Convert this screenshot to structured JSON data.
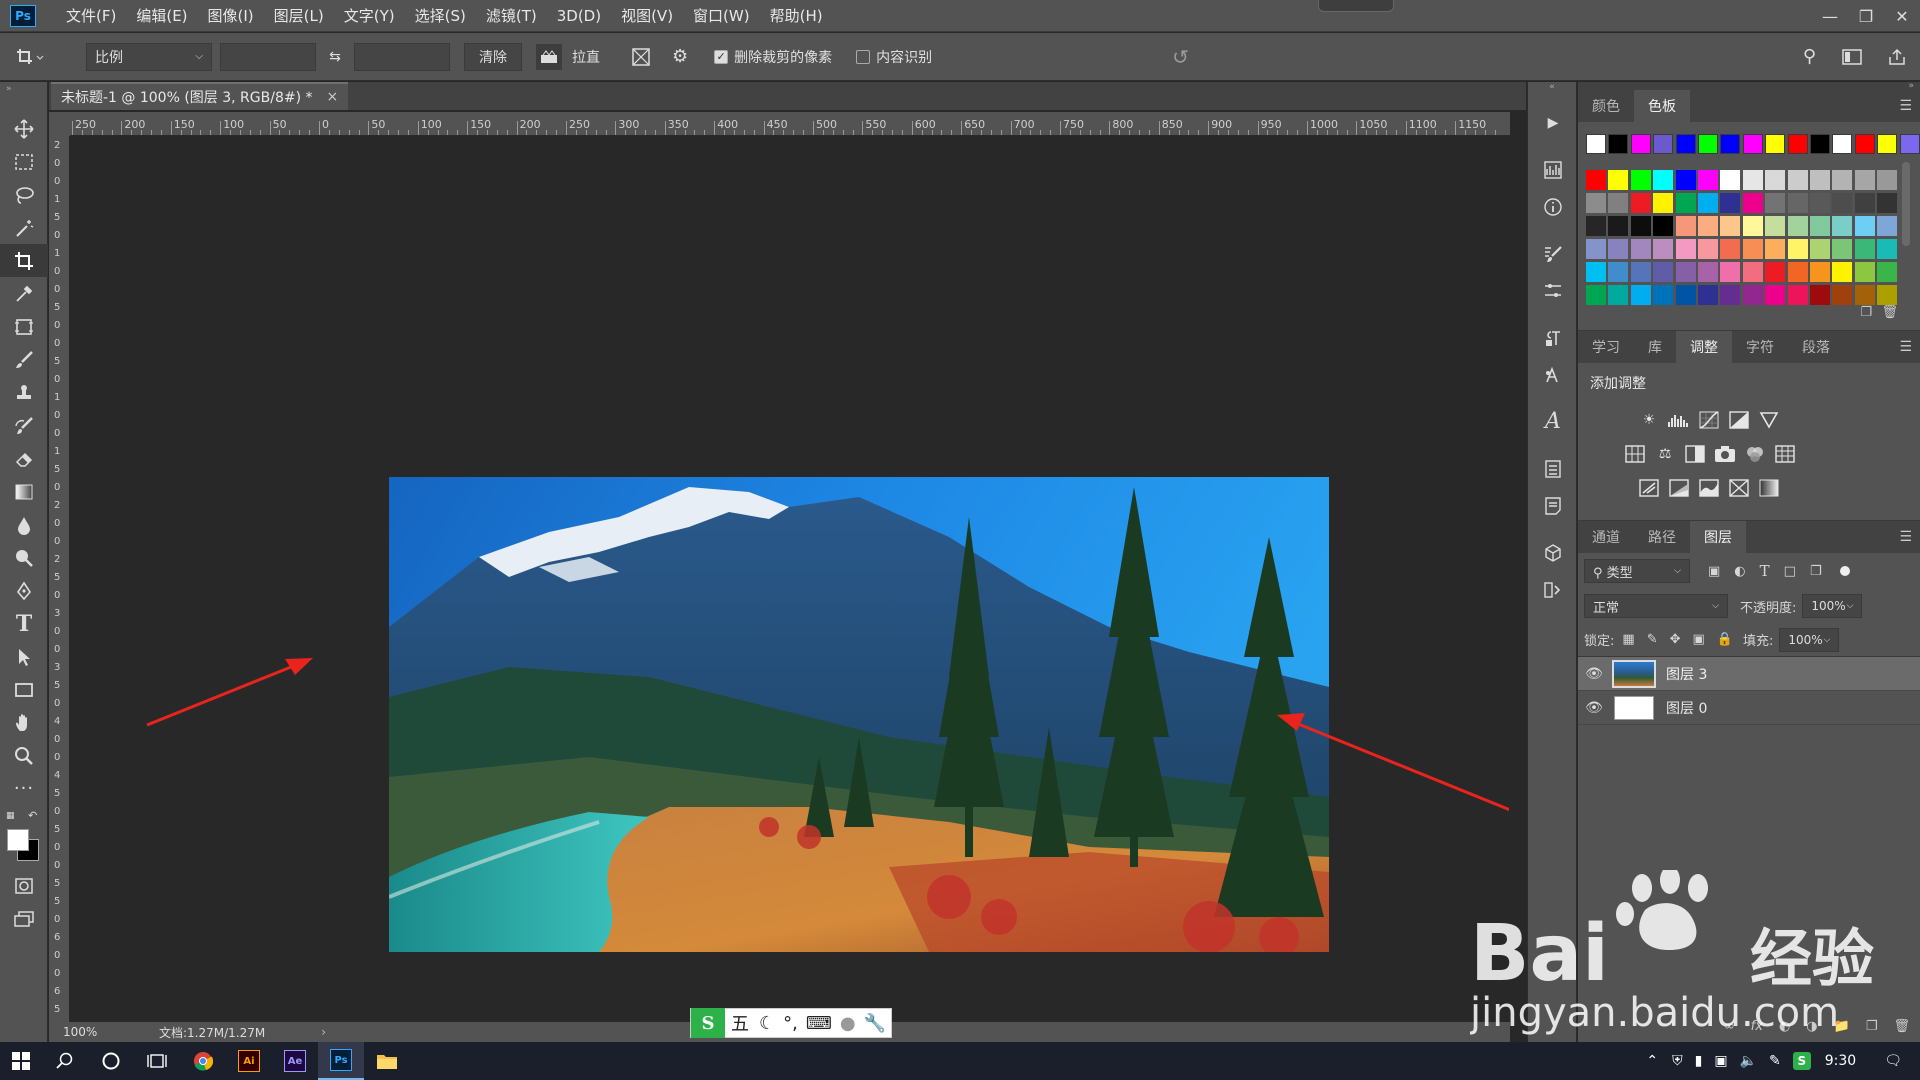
{
  "app": {
    "logo": "Ps"
  },
  "menu": [
    "文件(F)",
    "编辑(E)",
    "图像(I)",
    "图层(L)",
    "文字(Y)",
    "选择(S)",
    "滤镜(T)",
    "3D(D)",
    "视图(V)",
    "窗口(W)",
    "帮助(H)"
  ],
  "options": {
    "ratio_label": "比例",
    "width_value": "",
    "height_value": "",
    "clear_label": "清除",
    "straighten_label": "拉直",
    "delete_cropped_label": "删除裁剪的像素",
    "delete_cropped_checked": true,
    "content_aware_label": "内容识别",
    "content_aware_checked": false
  },
  "document": {
    "tab_title": "未标题-1 @ 100% (图层 3, RGB/8#) *",
    "zoom": "100%",
    "doc_info": "文档:1.27M/1.27M"
  },
  "ruler": {
    "h_labels": [
      "250",
      "200",
      "150",
      "100",
      "50",
      "0",
      "50",
      "100",
      "150",
      "200",
      "250",
      "300",
      "350",
      "400",
      "450",
      "500",
      "550",
      "600",
      "650",
      "700",
      "750",
      "800",
      "850",
      "900",
      "950",
      "1000",
      "1050",
      "1100",
      "1150"
    ],
    "v_labels": [
      "2",
      "0",
      "0",
      "1",
      "5",
      "0",
      "1",
      "0",
      "0",
      "5",
      "0",
      "0",
      "5",
      "0",
      "1",
      "0",
      "0",
      "1",
      "5",
      "0",
      "2",
      "0",
      "0",
      "2",
      "5",
      "0",
      "3",
      "0",
      "0",
      "3",
      "5",
      "0",
      "4",
      "0",
      "0",
      "4",
      "5",
      "0",
      "5",
      "0",
      "0",
      "5",
      "5",
      "0",
      "6",
      "0",
      "0",
      "6",
      "5"
    ]
  },
  "swatches_panel": {
    "tabs": [
      "颜色",
      "色板"
    ],
    "active_tab": "色板",
    "row1": [
      "#ffffff",
      "#000000",
      "#ff00ff",
      "#6a5acd",
      "#0000ff",
      "#00ff00",
      "#0000ff",
      "#ff00ff",
      "#ffff00",
      "#ff0000",
      "#000000",
      "#ffffff",
      "#ff0000",
      "#ffff00",
      "#7b68ee"
    ],
    "grid": [
      [
        "#ff0000",
        "#ffff00",
        "#00ff00",
        "#00ffff",
        "#0000ff",
        "#ff00ff",
        "#ffffff",
        "#e6e6e6",
        "#d9d9d9",
        "#cccccc",
        "#bfbfbf",
        "#b3b3b3",
        "#a6a6a6",
        "#999999"
      ],
      [
        "#8c8c8c",
        "#808080",
        "#ed1c24",
        "#fff200",
        "#00a651",
        "#00aeef",
        "#2e3192",
        "#ec008c",
        "#737373",
        "#666666",
        "#595959",
        "#4d4d4d",
        "#404040",
        "#333333"
      ],
      [
        "#262626",
        "#1a1a1a",
        "#0d0d0d",
        "#000000",
        "#f7977a",
        "#f9ad81",
        "#fdc68a",
        "#fff79a",
        "#c4df9b",
        "#a3d39c",
        "#82ca9d",
        "#7bcdc8",
        "#6ecff6",
        "#7ea7d8"
      ],
      [
        "#8493ca",
        "#8882be",
        "#a187be",
        "#bc8dbf",
        "#f49ac2",
        "#f6989d",
        "#f26c4f",
        "#f68e55",
        "#fbaf5c",
        "#fff467",
        "#acd372",
        "#7cc576",
        "#3bb878",
        "#1abbb4"
      ],
      [
        "#00bff3",
        "#438ccb",
        "#5574b9",
        "#605ca8",
        "#855fa8",
        "#a763a8",
        "#f06ea9",
        "#f26d7d",
        "#ed1c24",
        "#f26522",
        "#f7941d",
        "#fff200",
        "#8dc63f",
        "#39b54a"
      ],
      [
        "#00a651",
        "#00a99d",
        "#00aeef",
        "#0072bc",
        "#0054a6",
        "#2e3192",
        "#662d91",
        "#92278f",
        "#ec008c",
        "#ed145b",
        "#9e0b0f",
        "#a0410d",
        "#a36209",
        "#aba000"
      ]
    ]
  },
  "adjust_panel": {
    "tabs": [
      "学习",
      "库",
      "调整",
      "字符",
      "段落"
    ],
    "active_tab": "调整",
    "title": "添加调整",
    "row1_icons": [
      "brightness-icon",
      "levels-icon",
      "curves-icon",
      "exposure-icon",
      "vibrance-icon"
    ],
    "row2_icons": [
      "hue-saturation-icon",
      "color-balance-icon",
      "black-white-icon",
      "photo-filter-icon",
      "channel-mixer-icon",
      "color-lookup-icon"
    ],
    "row3_icons": [
      "invert-icon",
      "posterize-icon",
      "threshold-icon",
      "selective-color-icon",
      "gradient-map-icon"
    ]
  },
  "layers_panel": {
    "tabs": [
      "通道",
      "路径",
      "图层"
    ],
    "active_tab": "图层",
    "filter_label": "类型",
    "blend_mode": "正常",
    "opacity_label": "不透明度:",
    "opacity_value": "100%",
    "lock_label": "锁定:",
    "fill_label": "填充:",
    "fill_value": "100%",
    "layers": [
      {
        "name": "图层 3",
        "selected": true,
        "thumb": "photo"
      },
      {
        "name": "图层 0",
        "selected": false,
        "thumb": "white"
      }
    ]
  },
  "taskbar": {
    "apps": [
      "Ai",
      "Ae",
      "Ps"
    ],
    "active_app": "Ps",
    "clock": "9:30"
  },
  "ime": {
    "mode_label": "五"
  },
  "watermark": {
    "brand": "Bai",
    "brand_cn": "经验",
    "url": "jingyan.baidu.com"
  },
  "colors": {
    "ui_panel": "#535353",
    "ui_dark": "#424242",
    "canvas_bg": "#282828",
    "arrow": "#e8241c",
    "taskbar": "#1a1f2b"
  }
}
